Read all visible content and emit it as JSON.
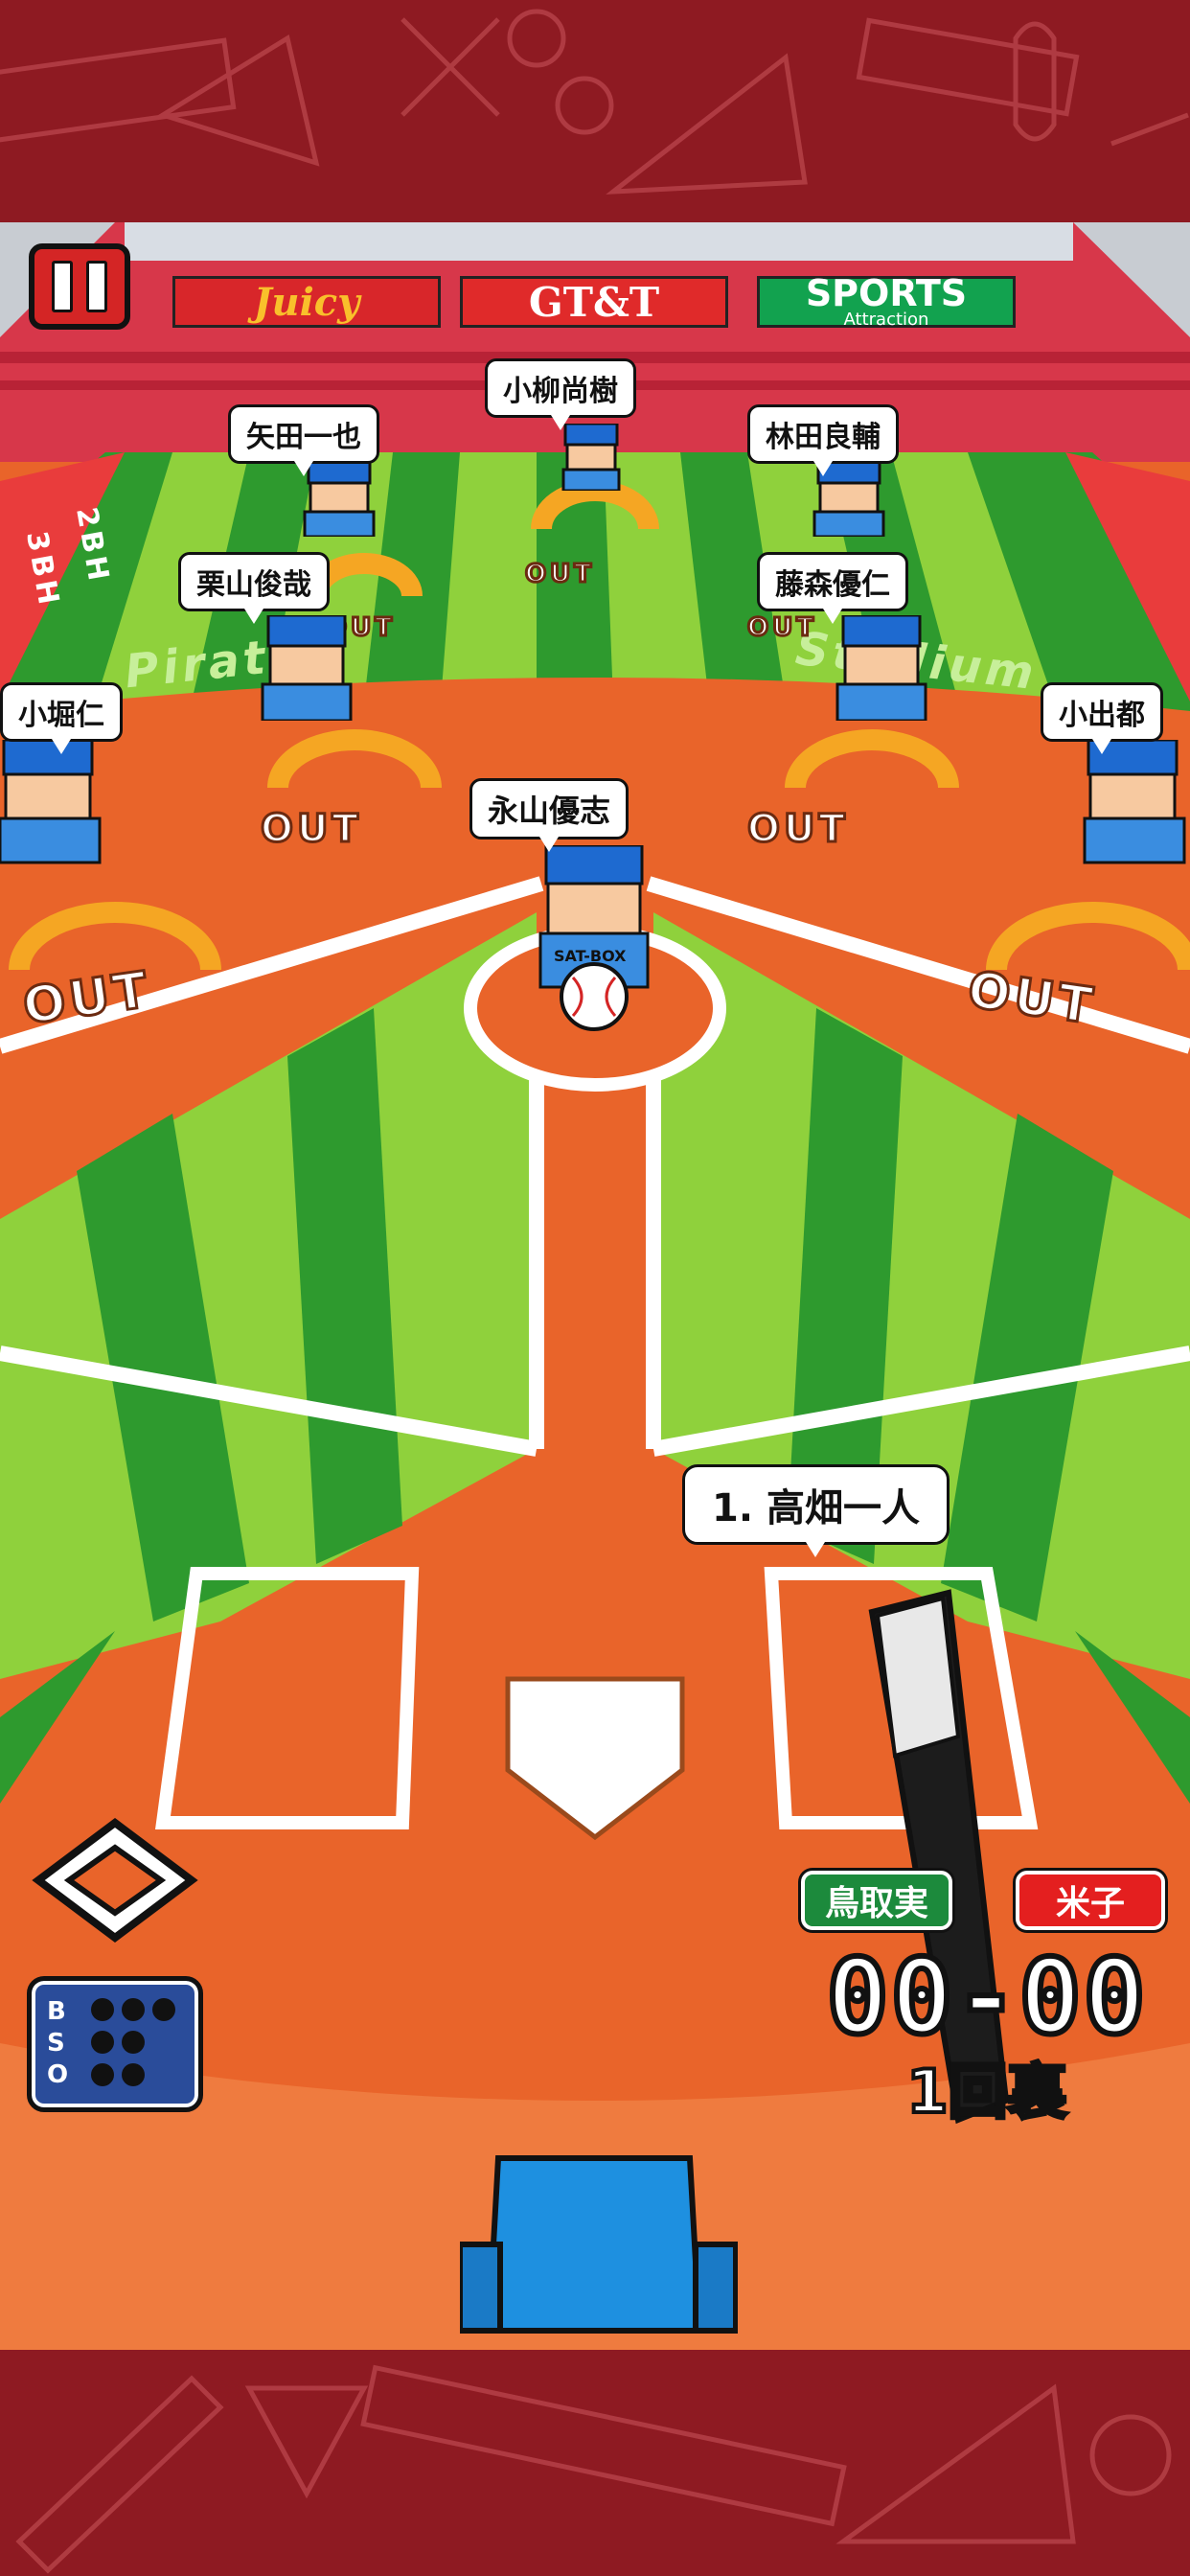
{
  "ads": {
    "juicy": "Juicy",
    "gtt": "GT&T",
    "sports": "SPORTS",
    "sports_sub": "Attraction"
  },
  "fielders": {
    "center": "小柳尚樹",
    "left_center": "矢田一也",
    "right_center": "林田良輔",
    "left_inner": "栗山俊哉",
    "right_inner": "藤森優仁",
    "far_left": "小堀仁",
    "far_right": "小出都",
    "pitcher": "永山優志"
  },
  "batter": "1. 高畑一人",
  "out_label": "OUT",
  "field_text": {
    "left": "Pirates",
    "right": "Stadium",
    "second_base": "2BH",
    "third_base": "3BH"
  },
  "jersey_text": "SAT-BOX",
  "scoreboard": {
    "home_team": "鳥取実",
    "away_team": "米子",
    "score": "00-00",
    "inning": "1回裏"
  },
  "bso": {
    "letters": [
      "B",
      "S",
      "O"
    ]
  },
  "colors": {
    "frame": "#8e1a22",
    "infield": "#e9642a",
    "grass_light": "#8fd13c",
    "grass_dark": "#2e9a2e",
    "home_team": "#1c8a3c",
    "away_team": "#e41f1f",
    "bso_panel": "#2a4c9a"
  },
  "icons": [
    "pause-icon",
    "base-diamond-icon",
    "baseball-icon",
    "bat-icon",
    "pitching-machine-icon"
  ]
}
